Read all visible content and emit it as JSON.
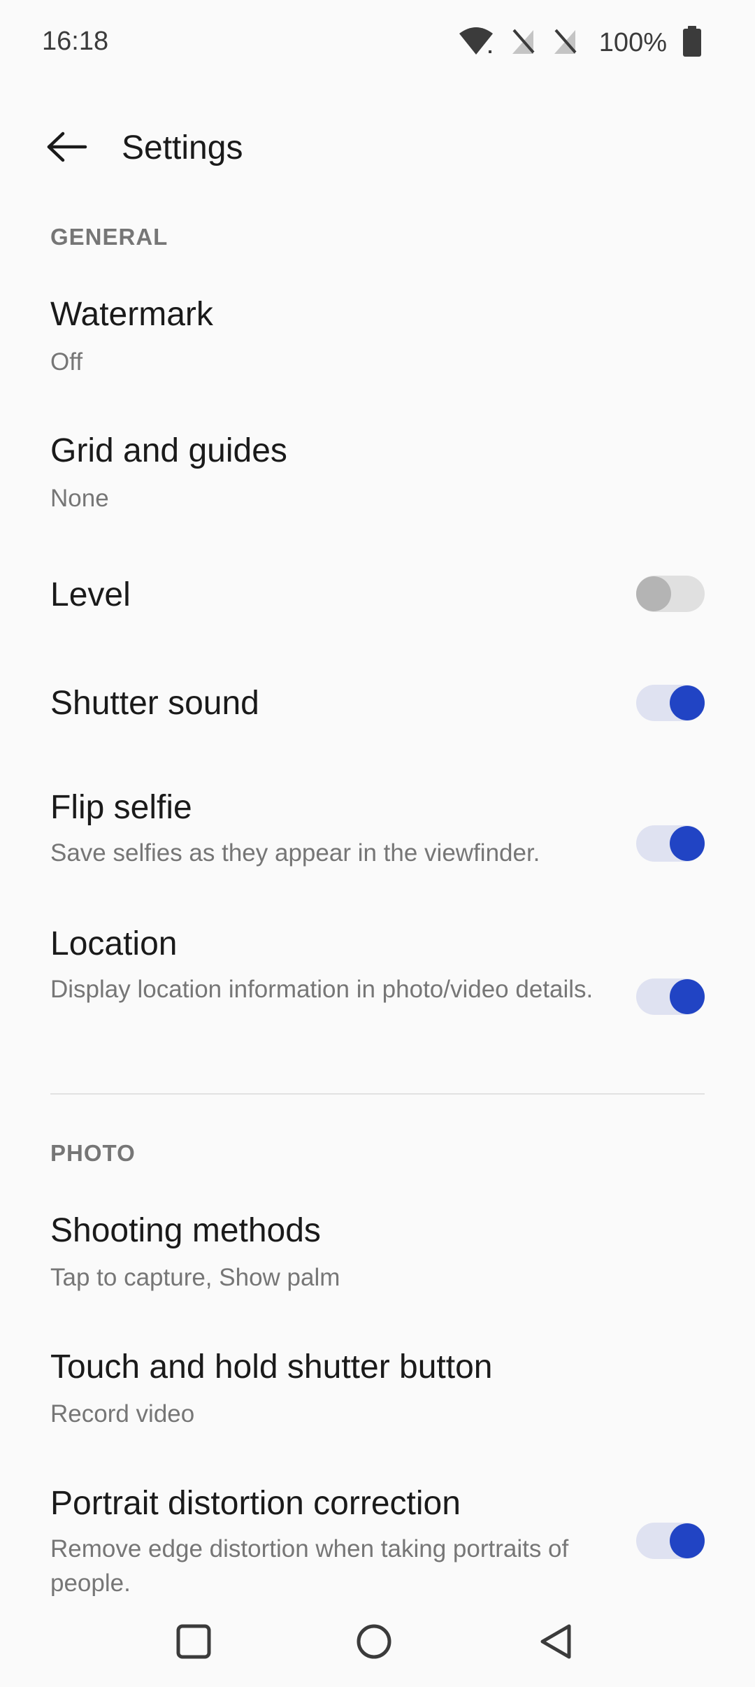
{
  "status_bar": {
    "time": "16:18",
    "battery": "100%",
    "icons": [
      "wifi-icon",
      "no-sim-icon",
      "no-sim-icon",
      "battery-icon"
    ]
  },
  "header": {
    "title": "Settings",
    "back_icon": "arrow-left-icon"
  },
  "sections": {
    "general": {
      "label": "GENERAL",
      "items": {
        "watermark": {
          "title": "Watermark",
          "value": "Off"
        },
        "grid": {
          "title": "Grid and guides",
          "value": "None"
        },
        "level": {
          "title": "Level",
          "toggle": "off"
        },
        "shutter_sound": {
          "title": "Shutter sound",
          "toggle": "on"
        },
        "flip_selfie": {
          "title": "Flip selfie",
          "subtitle": "Save selfies as they appear in the viewfinder.",
          "toggle": "on"
        },
        "location": {
          "title": "Location",
          "subtitle": "Display location information in photo/video details.",
          "toggle": "on"
        }
      }
    },
    "photo": {
      "label": "PHOTO",
      "items": {
        "shooting_methods": {
          "title": "Shooting methods",
          "value": "Tap to capture, Show palm"
        },
        "touch_hold": {
          "title": "Touch and hold shutter button",
          "value": "Record video"
        },
        "portrait_distortion": {
          "title": "Portrait distortion correction",
          "subtitle": "Remove edge distortion when taking portraits of people.",
          "toggle": "on"
        }
      }
    }
  },
  "colors": {
    "accent": "#2144c4",
    "toggle_on_track": "#dfe2f1",
    "toggle_off_track": "#e0e0e0",
    "toggle_off_thumb": "#b4b4b4",
    "secondary_text": "#767676",
    "background": "#fafafa"
  },
  "nav_bar": {
    "buttons": [
      "recents-square-icon",
      "home-circle-icon",
      "back-triangle-icon"
    ]
  }
}
